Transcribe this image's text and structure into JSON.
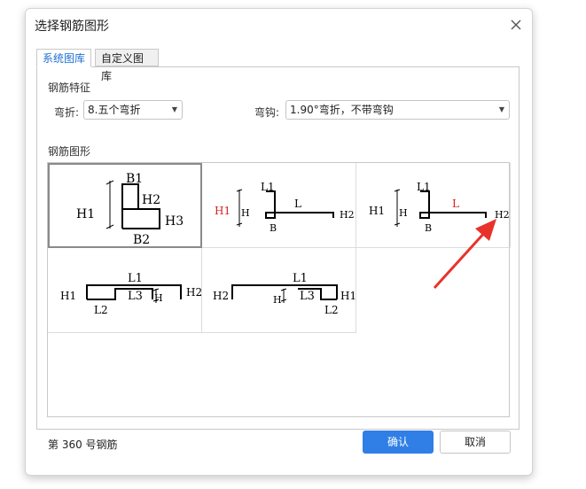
{
  "dialog": {
    "title": "选择钢筋图形"
  },
  "tabs": [
    {
      "label": "系统图库"
    },
    {
      "label": "自定义图库"
    }
  ],
  "features": {
    "section_label": "钢筋特征",
    "bend_label": "弯折:",
    "bend_value": "8.五个弯折",
    "hook_label": "弯钩:",
    "hook_value": "1.90°弯折，不带弯钩"
  },
  "shapes": {
    "section_label": "钢筋图形",
    "cells": [
      {
        "labels": {
          "b1": "B1",
          "h2": "H2",
          "h1": "H1",
          "h3": "H3",
          "b2": "B2"
        }
      },
      {
        "labels": {
          "l1": "L1",
          "l": "L",
          "h1": "H1",
          "h": "H",
          "h2": "H2",
          "b": "B"
        }
      },
      {
        "labels": {
          "l1": "L1",
          "l": "L",
          "h1": "H1",
          "h": "H",
          "h2": "H2",
          "b": "B"
        }
      },
      {
        "labels": {
          "l1": "L1",
          "h1": "H1",
          "l3": "L3",
          "h": "H",
          "h2": "H2",
          "l2": "L2"
        }
      },
      {
        "labels": {
          "l1": "L1",
          "h2": "H2",
          "h": "H",
          "l3": "L3",
          "h1": "H1",
          "l2": "L2"
        }
      }
    ]
  },
  "footer": {
    "rebar_number": "第 360 号钢筋",
    "ok_label": "确认",
    "cancel_label": "取消"
  },
  "colors": {
    "accent": "#2f7fe6",
    "highlight_red": "#d42020",
    "arrow_red": "#e8332b"
  }
}
